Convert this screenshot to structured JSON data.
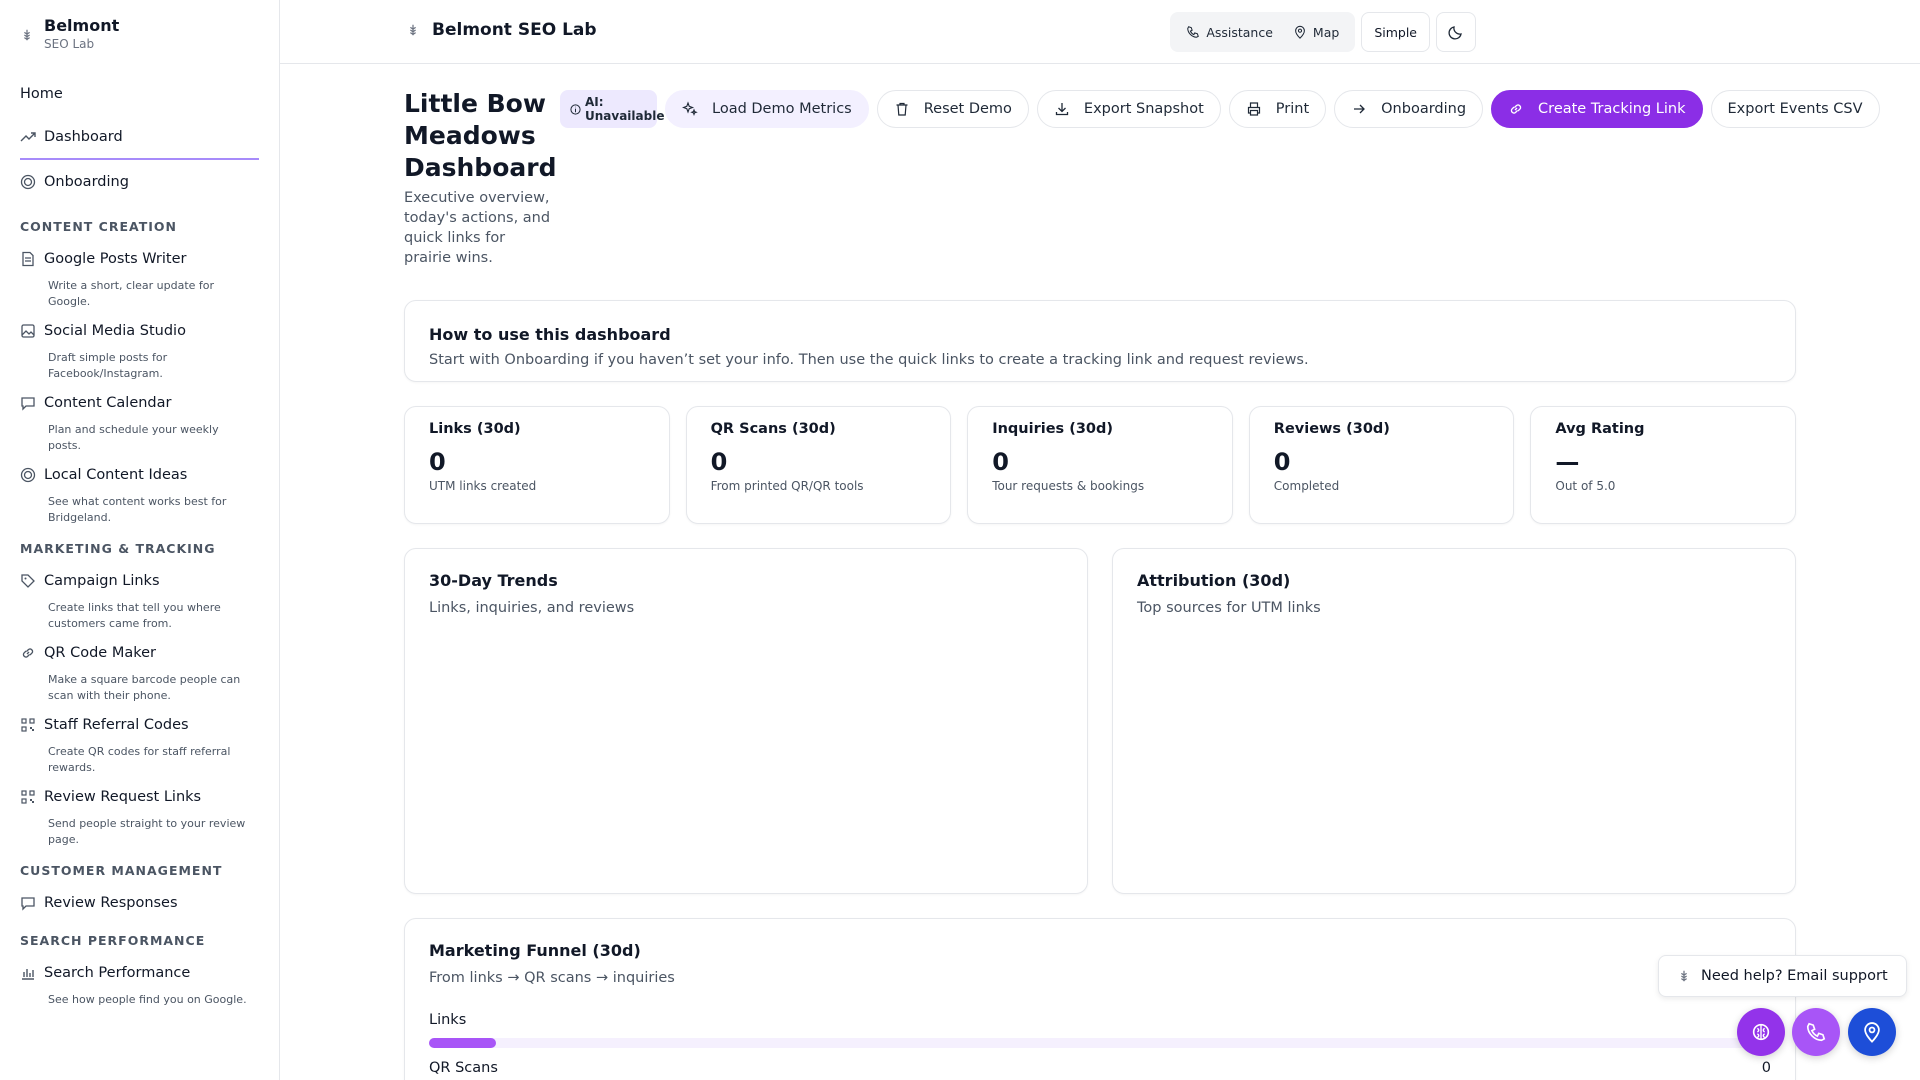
{
  "brand": {
    "name": "Belmont",
    "sub": "SEO Lab"
  },
  "nav": {
    "home": "Home",
    "dashboard": "Dashboard",
    "onboarding": "Onboarding"
  },
  "sections": {
    "content": "CONTENT CREATION",
    "marketing": "MARKETING & TRACKING",
    "customer": "CUSTOMER MANAGEMENT",
    "search": "SEARCH PERFORMANCE"
  },
  "items": {
    "google_posts": {
      "label": "Google Posts Writer",
      "desc": "Write a short, clear update for Google.",
      "icon": "document-icon"
    },
    "social": {
      "label": "Social Media Studio",
      "desc": "Draft simple posts for Facebook/Instagram.",
      "icon": "image-icon"
    },
    "calendar": {
      "label": "Content Calendar",
      "desc": "Plan and schedule your weekly posts.",
      "icon": "chat-icon"
    },
    "ideas": {
      "label": "Local Content Ideas",
      "desc": "See what content works best for Bridgeland.",
      "icon": "target-icon"
    },
    "campaign": {
      "label": "Campaign Links",
      "desc": "Create links that tell you where customers came from.",
      "icon": "tag-icon"
    },
    "qr": {
      "label": "QR Code Maker",
      "desc": "Make a square barcode people can scan with their phone.",
      "icon": "link-icon"
    },
    "staff": {
      "label": "Staff Referral Codes",
      "desc": "Create QR codes for staff referral rewards.",
      "icon": "qr-icon"
    },
    "review_links": {
      "label": "Review Request Links",
      "desc": "Send people straight to your review page.",
      "icon": "qr-icon"
    },
    "review_resp": {
      "label": "Review Responses",
      "icon": "chat-icon"
    },
    "search_perf": {
      "label": "Search Performance",
      "desc": "See how people find you on Google.",
      "icon": "bar-chart-icon"
    }
  },
  "topbar": {
    "title": "Belmont SEO Lab",
    "assistance": "Assistance",
    "map": "Map",
    "simple": "Simple"
  },
  "page": {
    "title": "Little Bow Meadows Dashboard",
    "subtitle": "Executive overview, today's actions, and quick links for prairie wins."
  },
  "actions": {
    "ai": "AI: Unavailable",
    "load_demo": "Load Demo Metrics",
    "reset_demo": "Reset Demo",
    "export_snapshot": "Export Snapshot",
    "print": "Print",
    "onboarding": "Onboarding",
    "create_link": "Create Tracking Link",
    "export_csv": "Export Events CSV"
  },
  "howto": {
    "title": "How to use this dashboard",
    "text": "Start with Onboarding if you haven’t set your info. Then use the quick links to create a tracking link and request reviews."
  },
  "kpis": [
    {
      "label": "Links (30d)",
      "value": "0",
      "caption": "UTM links created"
    },
    {
      "label": "QR Scans (30d)",
      "value": "0",
      "caption": "From printed QR/QR tools"
    },
    {
      "label": "Inquiries (30d)",
      "value": "0",
      "caption": "Tour requests & bookings"
    },
    {
      "label": "Reviews (30d)",
      "value": "0",
      "caption": "Completed"
    },
    {
      "label": "Avg Rating",
      "value": "—",
      "caption": "Out of 5.0"
    }
  ],
  "charts": {
    "trends": {
      "title": "30-Day Trends",
      "subtitle": "Links, inquiries, and reviews"
    },
    "attribution": {
      "title": "Attribution (30d)",
      "subtitle": "Top sources for UTM links"
    }
  },
  "funnel": {
    "title": "Marketing Funnel (30d)",
    "subtitle": "From links → QR scans → inquiries",
    "rows": [
      {
        "label": "Links",
        "value": "",
        "fill_fraction": 0.05
      },
      {
        "label": "QR Scans",
        "value": "0"
      }
    ]
  },
  "help": {
    "label": "Need help? Email support"
  },
  "colors": {
    "accent": "#8b2ee6",
    "fab_purple": "#9333ea",
    "fab_violet": "#a855f7",
    "fab_blue": "#1d4ed8"
  }
}
